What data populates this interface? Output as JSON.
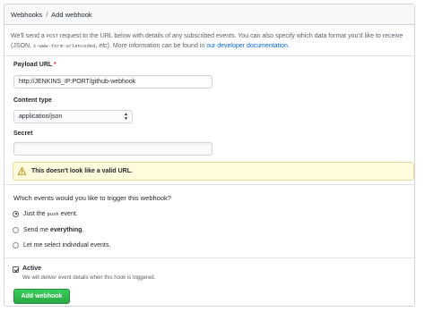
{
  "breadcrumb": {
    "parent": "Webhooks",
    "separator": "/",
    "current": "Add webhook"
  },
  "intro": {
    "part1": "We'll send a ",
    "post_code": "POST",
    "part2": " request to the URL below with details of any subscribed events. You can also specify which data format you'd like to receive (JSON, ",
    "form_code": "x-www-form-urlencoded",
    "part3": ", ",
    "etc": "etc",
    "part4": "). More information can be found in ",
    "link": "our developer documentation",
    "part5": "."
  },
  "payload_url": {
    "label": "Payload URL",
    "required_mark": "*",
    "value": "http://JENKINS_IP:PORT/github-webhook"
  },
  "content_type": {
    "label": "Content type",
    "selected": "application/json"
  },
  "secret": {
    "label": "Secret",
    "value": ""
  },
  "flash": {
    "message": "This doesn't look like a valid URL.",
    "icon": "alert-icon",
    "color": "#fffbdd"
  },
  "events": {
    "question": "Which events would you like to trigger this webhook?",
    "options": [
      {
        "prefix": "Just the ",
        "code": "push",
        "suffix": " event.",
        "checked": true
      },
      {
        "prefix": "Send me ",
        "bold": "everything",
        "suffix": ".",
        "checked": false
      },
      {
        "text": "Let me select individual events.",
        "checked": false
      }
    ]
  },
  "active": {
    "label": "Active",
    "checked": true,
    "note": "We will deliver event details when this hook is triggered."
  },
  "submit": {
    "label": "Add webhook",
    "color": "#28a745"
  }
}
